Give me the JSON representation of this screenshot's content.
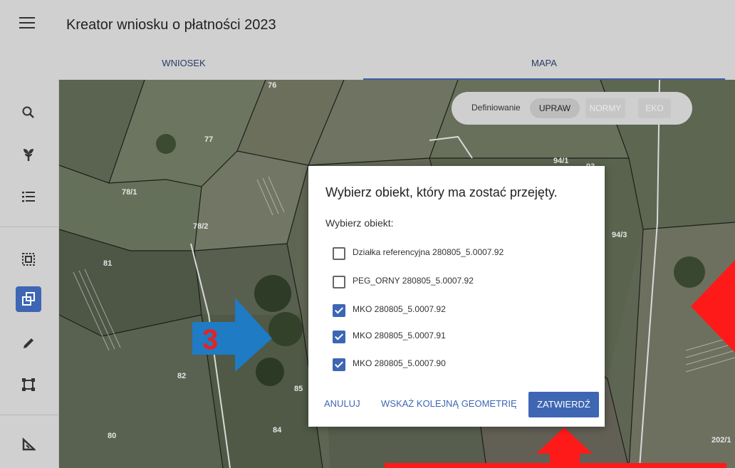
{
  "app": {
    "title": "Kreator wniosku o płatności 2023"
  },
  "tabs": [
    {
      "label": "WNIOSEK"
    },
    {
      "label": "MAPA",
      "active": true
    }
  ],
  "toolbar": {
    "tools": [
      "search-icon",
      "plant-icon",
      "list-icon",
      "select-area-icon",
      "copy-geometry-icon",
      "pencil-icon",
      "bounding-box-icon",
      "measure-icon"
    ],
    "active_tool": "copy-geometry-icon"
  },
  "map": {
    "labels": [
      "76",
      "77",
      "78/1",
      "78/2",
      "81",
      "82",
      "80",
      "84",
      "85",
      "94/1",
      "93",
      "94/3",
      "202/1"
    ]
  },
  "definiowanie": {
    "label": "Definiowanie",
    "options": [
      "UPRAW",
      "NORMY",
      "EKO"
    ],
    "selected": "UPRAW"
  },
  "dialog": {
    "title": "Wybierz obiekt, który ma zostać przejęty.",
    "subtitle": "Wybierz obiekt:",
    "options": [
      {
        "label": "Działka referencyjna 280805_5.0007.92",
        "checked": false
      },
      {
        "label": "PEG_ORNY 280805_5.0007.92",
        "checked": false
      },
      {
        "label": "MKO 280805_5.0007.92",
        "checked": true
      },
      {
        "label": "MKO 280805_5.0007.91",
        "checked": true
      },
      {
        "label": "MKO 280805_5.0007.90",
        "checked": true
      }
    ],
    "buttons": {
      "cancel": "ANULUJ",
      "next": "WSKAŻ KOLEJNĄ GEOMETRIĘ",
      "confirm": "ZATWIERDŹ"
    }
  },
  "annotations": {
    "step_number": "3"
  },
  "colors": {
    "accent": "#3e66b3",
    "annotation_blue": "#1e7bc4",
    "annotation_red": "#ff1a1a"
  }
}
